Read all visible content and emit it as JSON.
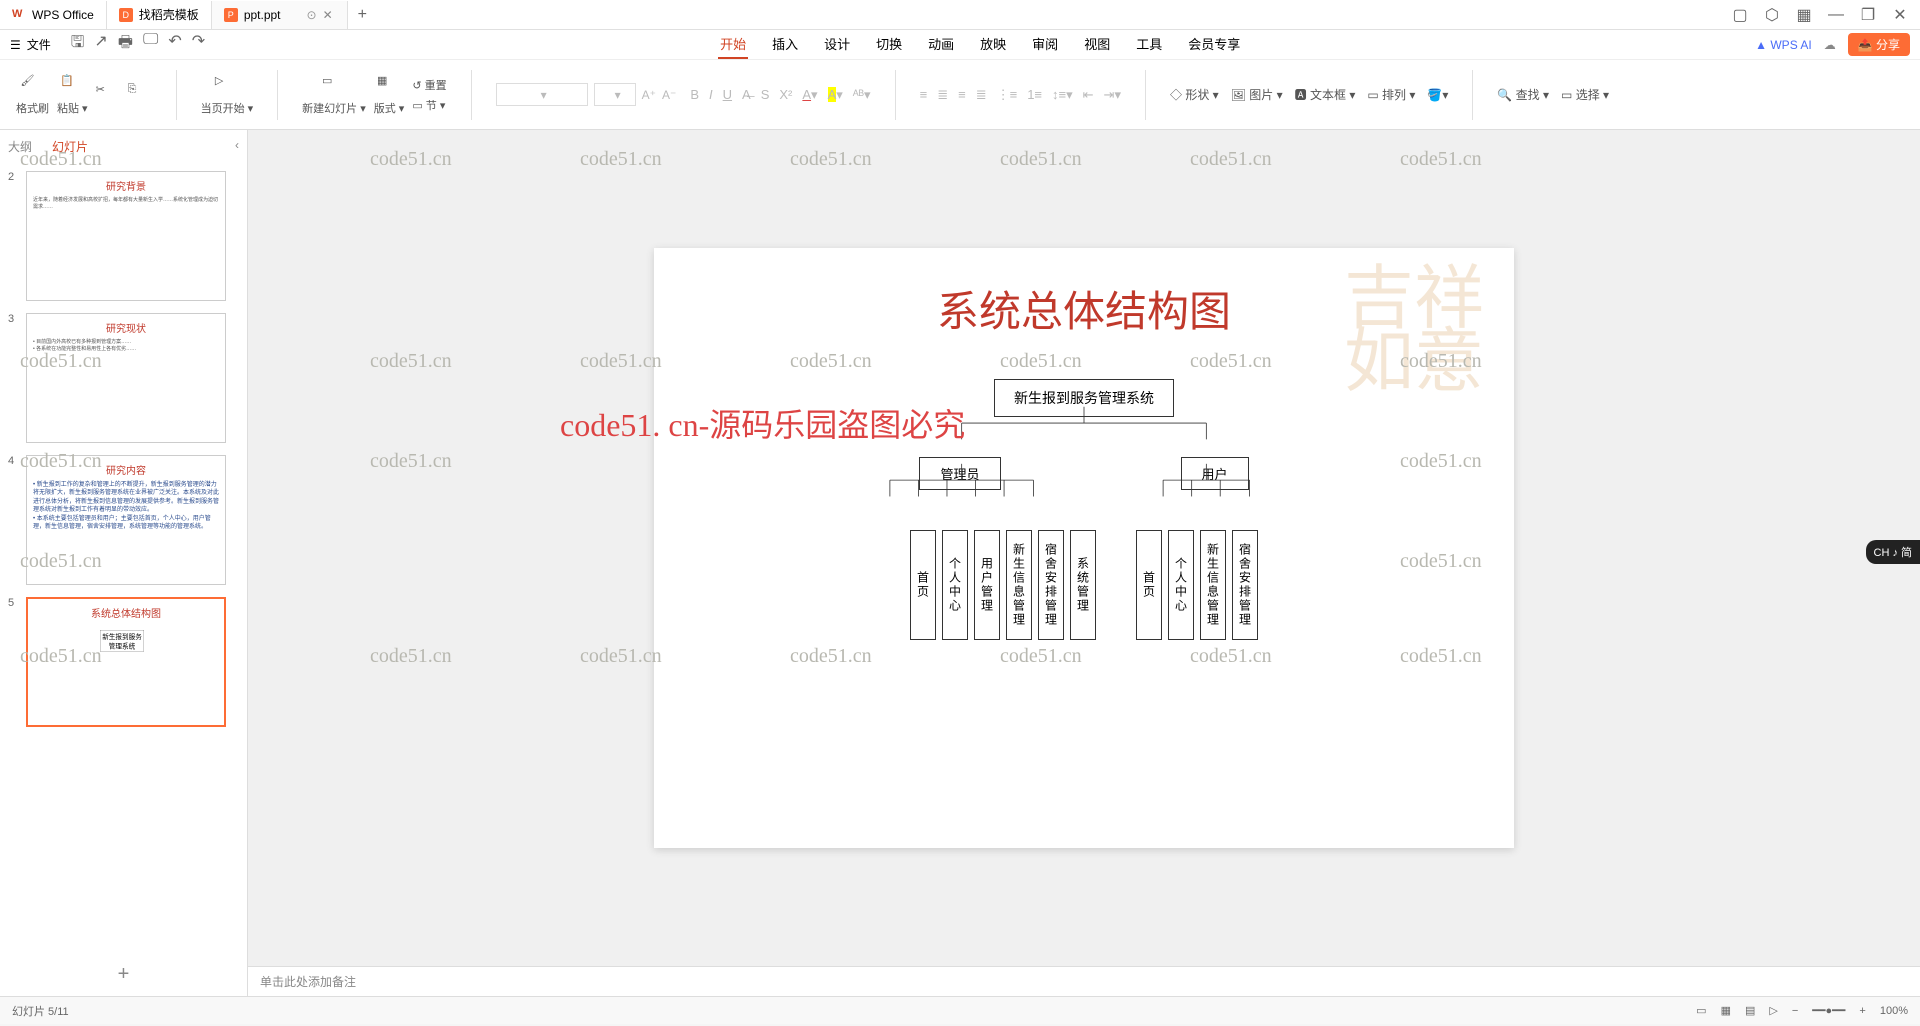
{
  "tabs": [
    {
      "icon": "W",
      "label": "WPS Office",
      "color": "#d14424"
    },
    {
      "icon": "D",
      "label": "找稻壳模板",
      "color": "#fd6c35"
    },
    {
      "icon": "P",
      "label": "ppt.ppt",
      "color": "#fd6c35",
      "active": true
    }
  ],
  "file_menu": "文件",
  "menu_tabs": [
    "开始",
    "插入",
    "设计",
    "切换",
    "动画",
    "放映",
    "审阅",
    "视图",
    "工具",
    "会员专享"
  ],
  "active_menu": "开始",
  "wps_ai": "WPS AI",
  "share": "分享",
  "ribbon": {
    "format_painter": "格式刷",
    "paste": "粘贴",
    "layout": "当页开始",
    "new_slide": "新建幻灯片",
    "template": "版式",
    "reset": "重置",
    "section": "节",
    "shape": "形状",
    "image": "图片",
    "textbox": "文本框",
    "arrange": "排列",
    "find": "查找",
    "select": "选择"
  },
  "panel": {
    "outline": "大纲",
    "slides": "幻灯片"
  },
  "thumbs": [
    {
      "num": "2",
      "title": "研究背景"
    },
    {
      "num": "3",
      "title": "研究现状"
    },
    {
      "num": "4",
      "title": "研究内容"
    },
    {
      "num": "5",
      "title": "系统总体结构图",
      "selected": true
    }
  ],
  "slide": {
    "title": "系统总体结构图",
    "root": "新生报到服务管理系统",
    "mid": [
      "管理员",
      "用户"
    ],
    "admin_leaves": [
      "首页",
      "个人中心",
      "用户管理",
      "新生信息管理",
      "宿舍安排管理",
      "系统管理"
    ],
    "user_leaves": [
      "首页",
      "个人中心",
      "新生信息管理",
      "宿舍安排管理"
    ]
  },
  "notes_placeholder": "单击此处添加备注",
  "watermark": "code51.cn",
  "watermark_red": "code51. cn-源码乐园盗图必究",
  "ime": "CH ♪ 简",
  "status": {
    "slide_info": "幻灯片 5/11",
    "zoom": "100%"
  }
}
